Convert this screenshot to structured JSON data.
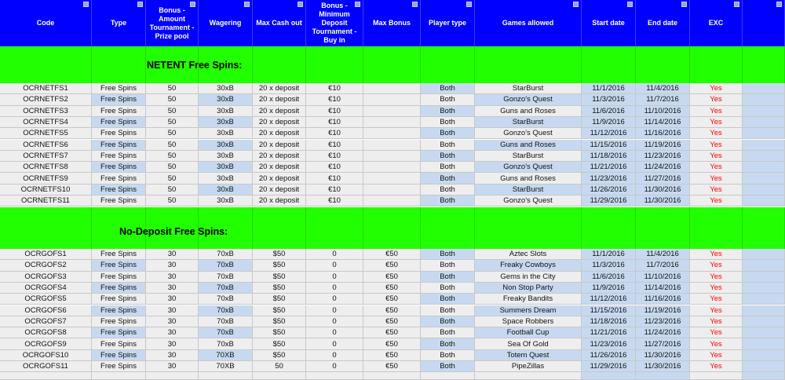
{
  "headers": [
    "Code",
    "Type",
    "Bonus - Amount Tournament - Prize pool",
    "Wagering",
    "Max Cash out",
    "Bonus - Minimum Deposit Tournament - Buy in",
    "Max Bonus",
    "Player type",
    "Games allowed",
    "Start date",
    "End date",
    "EXC",
    ""
  ],
  "sections": [
    {
      "title": "NETENT Free Spins:",
      "rows": [
        [
          "OCRNETFS1",
          "Free Spins",
          "50",
          "30xB",
          "20 x deposit",
          "€10",
          "",
          "Both",
          "StarBurst",
          "11/1/2016",
          "11/4/2016",
          "Yes",
          ""
        ],
        [
          "OCRNETFS2",
          "Free Spins",
          "50",
          "30xB",
          "20 x deposit",
          "€10",
          "",
          "Both",
          "Gonzo's Quest",
          "11/3/2016",
          "11/7/2016",
          "Yes",
          ""
        ],
        [
          "OCRNETFS3",
          "Free Spins",
          "50",
          "30xB",
          "20 x deposit",
          "€10",
          "",
          "Both",
          "Guns and Roses",
          "11/6/2016",
          "11/10/2016",
          "Yes",
          ""
        ],
        [
          "OCRNETFS4",
          "Free Spins",
          "50",
          "30xB",
          "20 x deposit",
          "€10",
          "",
          "Both",
          "StarBurst",
          "11/9/2016",
          "11/14/2016",
          "Yes",
          ""
        ],
        [
          "OCRNETFS5",
          "Free Spins",
          "50",
          "30xB",
          "20 x deposit",
          "€10",
          "",
          "Both",
          "Gonzo's Quest",
          "11/12/2016",
          "11/16/2016",
          "Yes",
          ""
        ],
        [
          "OCRNETFS6",
          "Free Spins",
          "50",
          "30xB",
          "20 x deposit",
          "€10",
          "",
          "Both",
          "Guns and Roses",
          "11/15/2016",
          "11/19/2016",
          "Yes",
          ""
        ],
        [
          "OCRNETFS7",
          "Free Spins",
          "50",
          "30xB",
          "20 x deposit",
          "€10",
          "",
          "Both",
          "StarBurst",
          "11/18/2016",
          "11/23/2016",
          "Yes",
          ""
        ],
        [
          "OCRNETFS8",
          "Free Spins",
          "50",
          "30xB",
          "20 x deposit",
          "€10",
          "",
          "Both",
          "Gonzo's Quest",
          "11/21/2016",
          "11/24/2016",
          "Yes",
          ""
        ],
        [
          "OCRNETFS9",
          "Free Spins",
          "50",
          "30xB",
          "20 x deposit",
          "€10",
          "",
          "Both",
          "Guns and Roses",
          "11/23/2016",
          "11/27/2016",
          "Yes",
          ""
        ],
        [
          "OCRNETFS10",
          "Free Spins",
          "50",
          "30xB",
          "20 x deposit",
          "€10",
          "",
          "Both",
          "StarBurst",
          "11/26/2016",
          "11/30/2016",
          "Yes",
          ""
        ],
        [
          "OCRNETFS11",
          "Free Spins",
          "50",
          "30xB",
          "20 x deposit",
          "€10",
          "",
          "Both",
          "Gonzo's Quest",
          "11/29/2016",
          "11/30/2016",
          "Yes",
          ""
        ]
      ]
    },
    {
      "title": "No-Deposit Free Spins:",
      "rows": [
        [
          "OCRGOFS1",
          "Free Spins",
          "30",
          "70xB",
          "$50",
          "0",
          "€50",
          "Both",
          "Aztec Slots",
          "11/1/2016",
          "11/4/2016",
          "Yes",
          ""
        ],
        [
          "OCRGOFS2",
          "Free Spins",
          "30",
          "70xB",
          "$50",
          "0",
          "€50",
          "Both",
          "Freaky Cowboys",
          "11/3/2016",
          "11/7/2016",
          "Yes",
          ""
        ],
        [
          "OCRGOFS3",
          "Free Spins",
          "30",
          "70xB",
          "$50",
          "0",
          "€50",
          "Both",
          "Gems in the City",
          "11/6/2016",
          "11/10/2016",
          "Yes",
          ""
        ],
        [
          "OCRGOFS4",
          "Free Spins",
          "30",
          "70xB",
          "$50",
          "0",
          "€50",
          "Both",
          "Non Stop Party",
          "11/9/2016",
          "11/14/2016",
          "Yes",
          ""
        ],
        [
          "OCRGOFS5",
          "Free Spins",
          "30",
          "70xB",
          "$50",
          "0",
          "€50",
          "Both",
          "Freaky Bandits",
          "11/12/2016",
          "11/16/2016",
          "Yes",
          ""
        ],
        [
          "OCRGOFS6",
          "Free Spins",
          "30",
          "70xB",
          "$50",
          "0",
          "€50",
          "Both",
          "Summers Dream",
          "11/15/2016",
          "11/19/2016",
          "Yes",
          ""
        ],
        [
          "OCRGOFS7",
          "Free Spins",
          "30",
          "70xB",
          "$50",
          "0",
          "€50",
          "Both",
          "Space Robbers",
          "11/18/2016",
          "11/23/2016",
          "Yes",
          ""
        ],
        [
          "OCRGOFS8",
          "Free Spins",
          "30",
          "70xB",
          "$50",
          "0",
          "€50",
          "Both",
          "Football Cup",
          "11/21/2016",
          "11/24/2016",
          "Yes",
          ""
        ],
        [
          "OCRGOFS9",
          "Free Spins",
          "30",
          "70xB",
          "$50",
          "0",
          "€50",
          "Both",
          "Sea Of Gold",
          "11/23/2016",
          "11/27/2016",
          "Yes",
          ""
        ],
        [
          "OCRGOFS10",
          "Free Spins",
          "30",
          "70XB",
          "$50",
          "0",
          "€50",
          "Both",
          "Totem Quest",
          "11/26/2016",
          "11/30/2016",
          "Yes",
          ""
        ],
        [
          "OCRGOFS11",
          "Free Spins",
          "30",
          "70XB",
          "50",
          "0",
          "€50",
          "Both",
          "PipeZillas",
          "11/29/2016",
          "11/30/2016",
          "Yes",
          ""
        ]
      ]
    }
  ],
  "colors": {
    "header_bg": "#0000ff",
    "header_text": "#ffffff",
    "section_bg": "#22ff00",
    "highlight_blue": "#c6d9f0",
    "plain_cell": "#eeeeee",
    "exc_text": "#ff0000"
  },
  "icons": {
    "header_filter": "filter-dropdown-icon"
  }
}
